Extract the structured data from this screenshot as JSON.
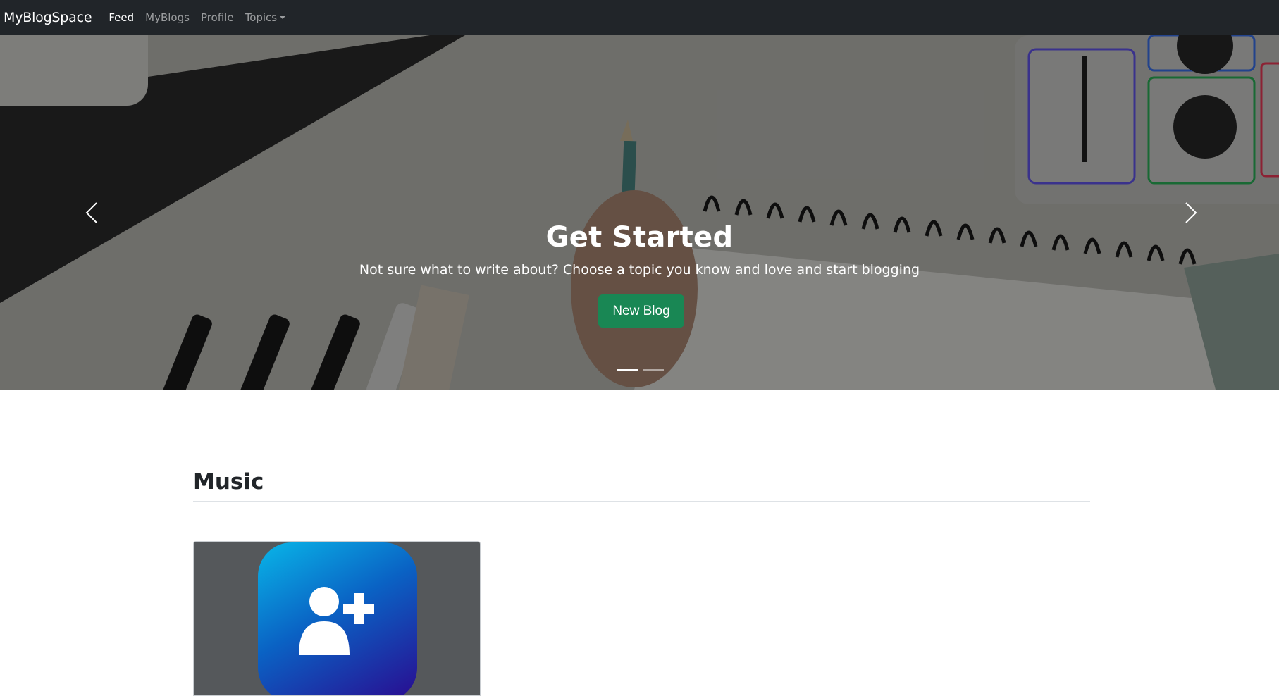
{
  "navbar": {
    "brand": "MyBlogSpace",
    "links": [
      "Feed",
      "MyBlogs",
      "Profile",
      "Topics"
    ],
    "active": "Feed"
  },
  "hero": {
    "title": "Get Started",
    "subtitle": "Not sure what to write about? Choose a topic you know and love and start blogging",
    "button": "New Blog",
    "button_color": "#198754",
    "slide_count": 2,
    "active_slide": 1
  },
  "section": {
    "title": "Music"
  },
  "card": {
    "icon": "add-user-icon",
    "gradient": [
      "#09b6e8",
      "#0a62c4",
      "#2a0a8f"
    ]
  },
  "colors": {
    "navbar_bg": "#212529",
    "page_bg": "#ffffff"
  }
}
